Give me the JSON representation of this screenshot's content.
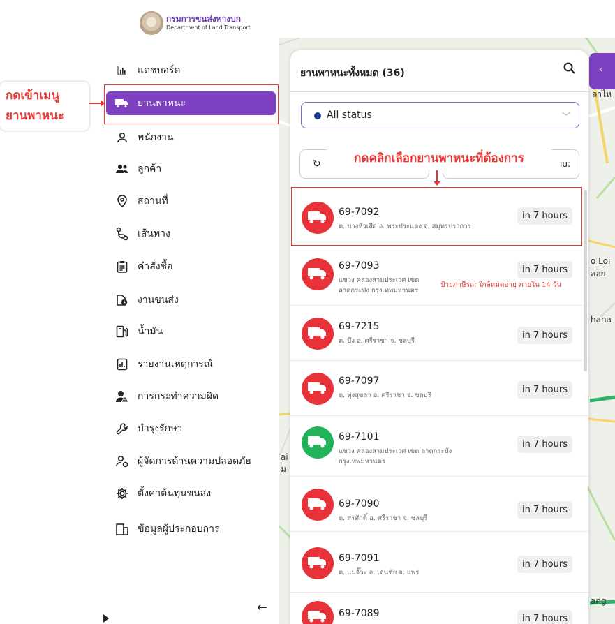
{
  "brand": {
    "name_th": "กรมการขนส่งทางบก",
    "name_en": "Department of Land Transport"
  },
  "menu": [
    {
      "label": "แดชบอร์ด",
      "icon": "bar-chart-icon"
    },
    {
      "label": "ยานพาหนะ",
      "icon": "truck-icon",
      "active": true
    },
    {
      "label": "พนักงาน",
      "icon": "person-icon"
    },
    {
      "label": "ลูกค้า",
      "icon": "people-icon"
    },
    {
      "label": "สถานที่",
      "icon": "location-pin-icon"
    },
    {
      "label": "เส้นทาง",
      "icon": "route-icon"
    },
    {
      "label": "คำสั่งซื้อ",
      "icon": "clipboard-icon"
    },
    {
      "label": "งานขนส่ง",
      "icon": "delivery-icon"
    },
    {
      "label": "น้ำมัน",
      "icon": "fuel-icon"
    },
    {
      "label": "รายงานเหตุการณ์",
      "icon": "report-icon"
    },
    {
      "label": "การกระทำความผิด",
      "icon": "violation-icon"
    },
    {
      "label": "บำรุงรักษา",
      "icon": "wrench-icon"
    },
    {
      "label": "ผู้จัดการด้านความปลอดภัย",
      "icon": "safety-manager-icon"
    },
    {
      "label": "ตั้งค่าต้นทุนขนส่ง",
      "icon": "gear-icon"
    },
    {
      "label": "ข้อมูลผู้ประกอบการ",
      "icon": "building-icon"
    }
  ],
  "annotations": {
    "menu_line1": "กดเข้าเมนู",
    "menu_line2": "ยานพาหนะ",
    "select_vehicle": "กดคลิกเลือกยานพาหนะที่ต้องการ"
  },
  "panel": {
    "title": "ยานพาหนะทั้งหมด (36)",
    "status_value": "All status",
    "right_button_partial": "ıu:"
  },
  "vehicles": [
    {
      "plate": "69-7092",
      "address": "ต. บางหัวเสือ อ. พระประแดง จ. สมุทรปราการ",
      "time": "in 7 hours",
      "color": "#e8323a"
    },
    {
      "plate": "69-7093",
      "address": "แขวง คลองสามประเวศ เขต ลาดกระบัง กรุงเทพมหานคร",
      "time": "in 7 hours",
      "warning": "ป้ายภาษีรถ: ใกล้หมดอายุ ภายใน 14 วัน",
      "color": "#e8323a"
    },
    {
      "plate": "69-7215",
      "address": "ต. บึง อ. ศรีราชา จ. ชลบุรี",
      "time": "in 7 hours",
      "color": "#e8323a"
    },
    {
      "plate": "69-7097",
      "address": "ต. ทุ่งสุขลา อ. ศรีราชา จ. ชลบุรี",
      "time": "in 7 hours",
      "color": "#e8323a"
    },
    {
      "plate": "69-7101",
      "address": "แขวง คลองสามประเวศ เขต ลาดกระบัง กรุงเทพมหานคร",
      "time": "in 7 hours",
      "color": "#22b35a"
    },
    {
      "plate": "69-7090",
      "address": "ต. สุรศักดิ์ อ. ศรีราชา จ. ชลบุรี",
      "time": "in 7 hours",
      "color": "#e8323a"
    },
    {
      "plate": "69-7091",
      "address": "ต. แม่จั๊วะ อ. เด่นชัย จ. แพร่",
      "time": "in 7 hours",
      "color": "#e8323a"
    },
    {
      "plate": "69-7089",
      "address": "",
      "time": "in 7 hours",
      "color": "#e8323a"
    }
  ],
  "map_labels": {
    "label_1": "ลาไห",
    "label_2": "o Loi",
    "label_3": "ลอย",
    "label_4": "hana",
    "label_5": "ai",
    "label_6": "ม",
    "label_7": "ang"
  }
}
